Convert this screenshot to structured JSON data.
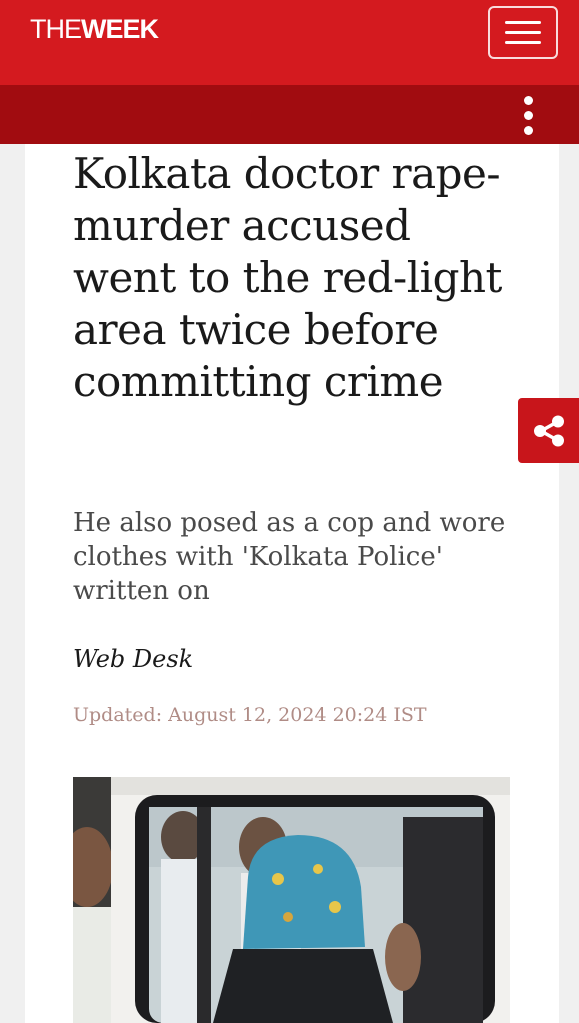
{
  "header": {
    "logo_the": "THE",
    "logo_week": "WEEK",
    "menu_icon": "hamburger-menu-icon",
    "more_icon": "vertical-dots-icon",
    "brand_color": "#d41a1f",
    "subbar_color": "#a10c10"
  },
  "article": {
    "headline": "Kolkata doctor rape-murder accused went to the red-light area twice before committing crime",
    "subheadline": "He also posed as a cop and wore clothes with 'Kolkata Police' written on",
    "author": "Web Desk",
    "updated": "Updated: August 12, 2024 20:24 IST"
  },
  "share": {
    "icon": "share-icon",
    "color": "#c8151b"
  }
}
